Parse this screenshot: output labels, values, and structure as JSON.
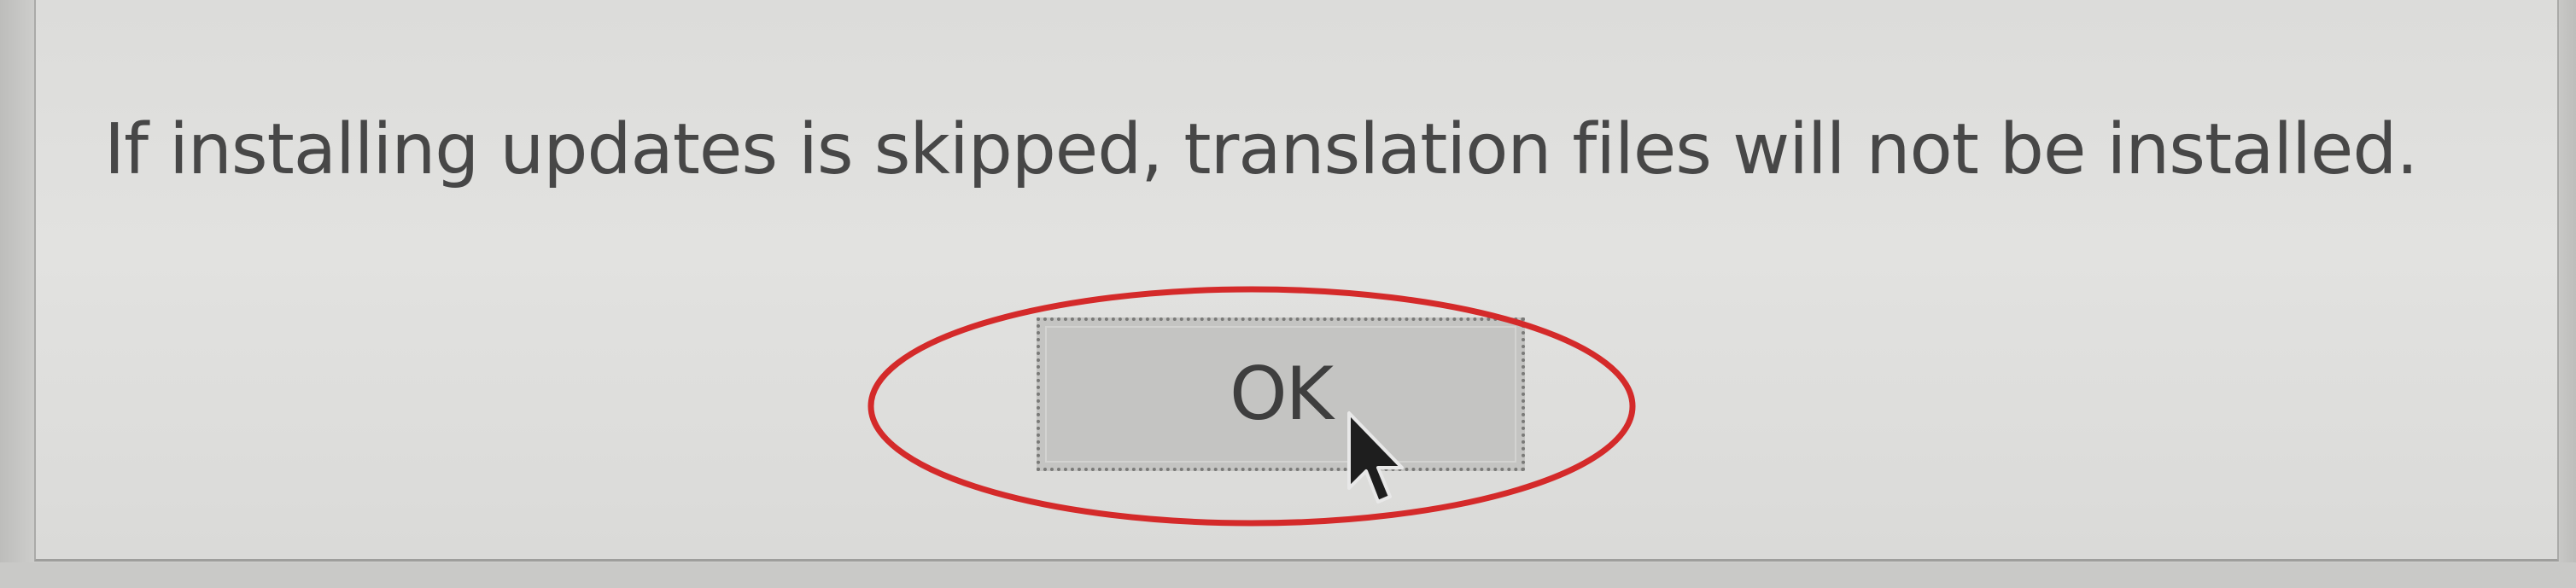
{
  "dialog": {
    "message": "If installing updates is skipped, translation files will not be installed.",
    "ok_label": "OK"
  },
  "annotation": {
    "type": "red-ellipse",
    "color": "#d42a2a",
    "target": "ok-button"
  },
  "icons": {
    "cursor": "mouse-pointer-icon"
  }
}
